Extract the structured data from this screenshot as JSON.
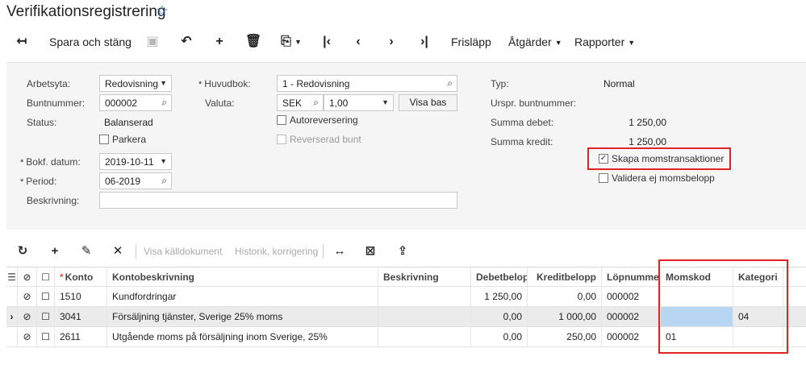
{
  "header": {
    "title": "Verifikationsregistrering",
    "favorite_icon": "star-outline-icon"
  },
  "toolbar": {
    "save_close_label": "Spara och stäng",
    "release_label": "Frisläpp",
    "actions_label": "Åtgärder",
    "reports_label": "Rapporter"
  },
  "form": {
    "workspace_label": "Arbetsyta:",
    "workspace_value": "Redovisning",
    "batch_number_label": "Buntnummer:",
    "batch_number_value": "000002",
    "status_label": "Status:",
    "status_value": "Balanserad",
    "hold_label": "Parkera",
    "posting_date_label": "Bokf. datum:",
    "posting_date_value": "2019-10-11",
    "period_label": "Period:",
    "period_value": "06-2019",
    "description_label": "Beskrivning:",
    "description_value": "",
    "ledger_label": "Huvudbok:",
    "ledger_value": "1 - Redovisning",
    "currency_label": "Valuta:",
    "currency_value": "SEK",
    "rate_value": "1,00",
    "view_base_label": "Visa bas",
    "auto_reversing_label": "Autoreversering",
    "reversing_batch_label": "Reverserad bunt",
    "type_label": "Typ:",
    "type_value": "Normal",
    "orig_batch_label": "Urspr. buntnummer:",
    "orig_batch_value": "",
    "debit_total_label": "Summa debet:",
    "debit_total_value": "1 250,00",
    "credit_total_label": "Summa kredit:",
    "credit_total_value": "1 250,00",
    "create_vat_label": "Skapa momstransaktioner",
    "create_vat_checked": true,
    "no_validate_vat_label": "Validera ej momsbelopp",
    "no_validate_vat_checked": false
  },
  "grid_toolbar": {
    "view_source_label": "Visa källdokument",
    "history_label": "Historik, korrigering"
  },
  "grid": {
    "columns": {
      "account": "Konto",
      "account_desc": "Kontobeskrivning",
      "description": "Beskrivning",
      "debit": "Debetbelopp",
      "credit": "Kreditbelopp",
      "line_number": "Löpnummer",
      "vat_code": "Momskod",
      "category": "Kategori"
    },
    "rows": [
      {
        "account": "1510",
        "account_desc": "Kundfordringar",
        "description": "",
        "debit": "1 250,00",
        "credit": "0,00",
        "line_number": "000002",
        "vat_code": "",
        "category": ""
      },
      {
        "account": "3041",
        "account_desc": "Försäljning tjänster, Sverige 25% moms",
        "description": "",
        "debit": "0,00",
        "credit": "1 000,00",
        "line_number": "000002",
        "vat_code": "",
        "category": "04"
      },
      {
        "account": "2611",
        "account_desc": "Utgående moms på försäljning inom Sverige, 25%",
        "description": "",
        "debit": "0,00",
        "credit": "250,00",
        "line_number": "000002",
        "vat_code": "01",
        "category": ""
      }
    ]
  },
  "colors": {
    "highlight_red": "#e02424",
    "selected_cell": "#b8d5f1",
    "accent_blue": "#2f7bd6"
  }
}
